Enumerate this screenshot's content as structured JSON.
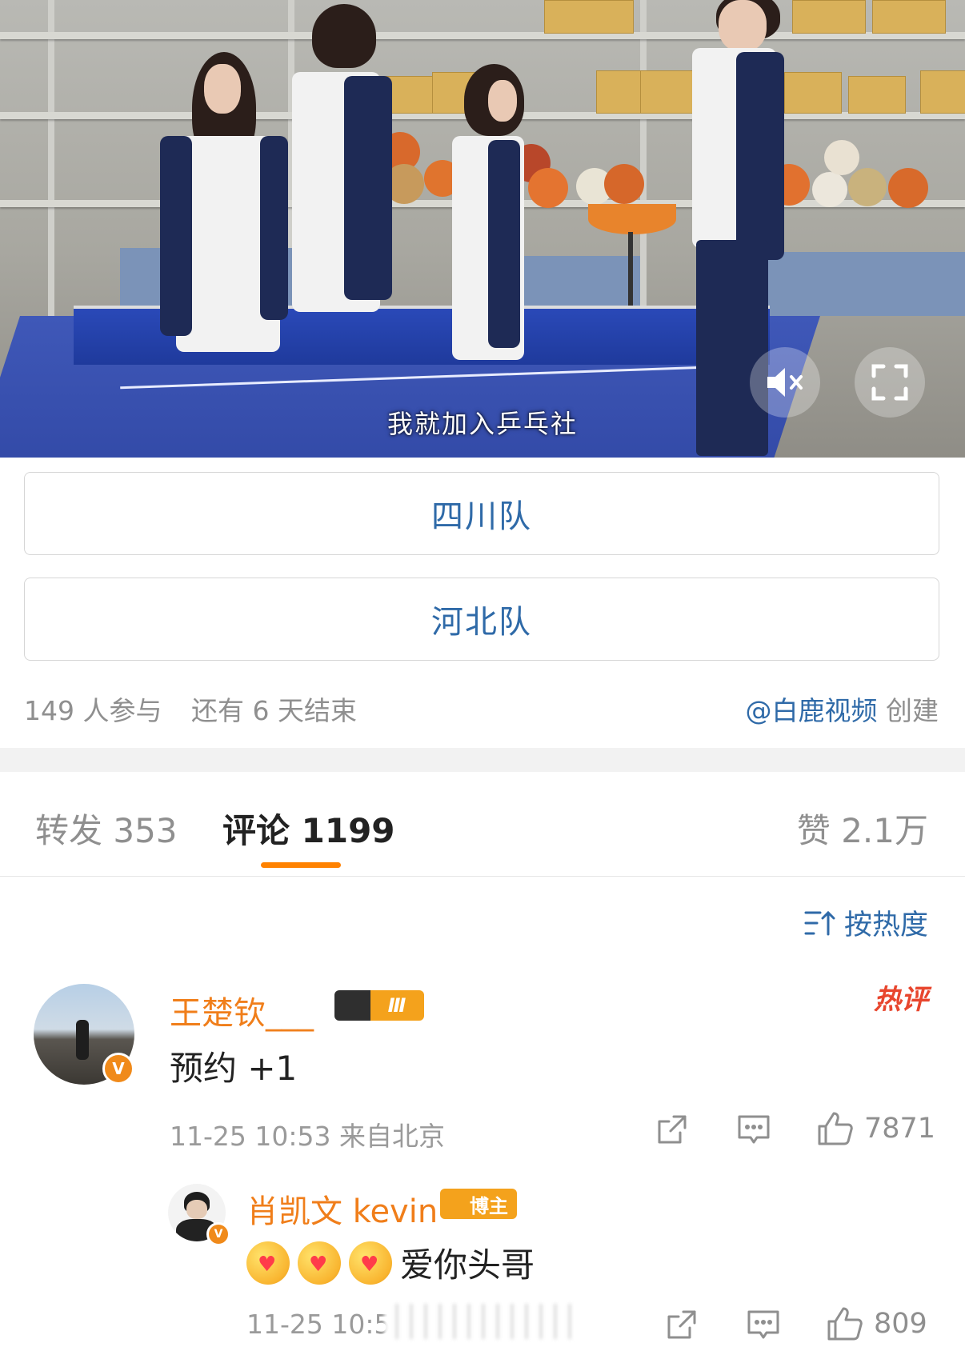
{
  "video": {
    "subtitle": "我就加入乒乓社",
    "mute_icon": "mute-icon",
    "fullscreen_icon": "fullscreen-icon"
  },
  "poll": {
    "options": [
      "四川队",
      "河北队"
    ],
    "participants": "149 人参与",
    "remaining": "还有 6 天结束",
    "creator_handle": "@白鹿视频",
    "creator_suffix": "创建"
  },
  "tabs": {
    "repost": "转发 353",
    "comments": "评论 1199",
    "likes": "赞 2.1万",
    "active": "comments",
    "accent_color": "#ff8200"
  },
  "sort": {
    "label": "按热度",
    "icon": "sort-icon"
  },
  "comments": [
    {
      "username": "王楚钦___",
      "badge": "Ⅲ",
      "text": "预约 +1",
      "tag": "热评",
      "time_location": "11-25 10:53  来自北京",
      "like_count": "7871",
      "reply": {
        "username": "肖凯文 kevin",
        "badge": "博主",
        "text": "爱你头哥",
        "emoji_count": 3,
        "time_location": "11-25 10:5",
        "like_count": "809"
      }
    }
  ],
  "colors": {
    "link_blue": "#2f6aa8",
    "username_orange": "#f07e1a",
    "hot_red": "#e8462e",
    "verified_orange": "#f08a1a"
  }
}
